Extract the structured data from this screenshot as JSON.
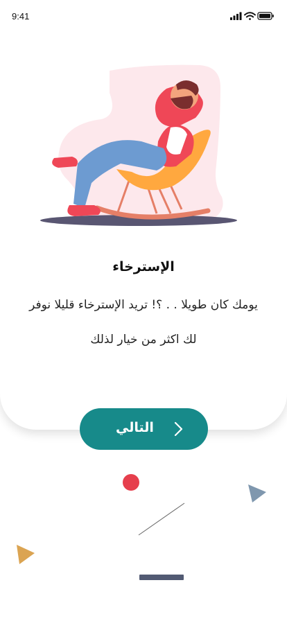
{
  "status_bar": {
    "time": "9:41"
  },
  "onboarding": {
    "title": "الإسترخاء",
    "description_line1": "يومك كان طويلا . . ؟! تريد الإسترخاء قليلا نوفر",
    "description_line2": "لك اكثر من خيار لذلك"
  },
  "next_button": {
    "label": "التالي"
  },
  "icons": {
    "next": "chevron-right-icon",
    "signal": "cellular-signal-icon",
    "wifi": "wifi-icon",
    "battery": "battery-icon"
  },
  "colors": {
    "accent": "#178a8a",
    "circle": "#e63f4d",
    "triangle_blue": "#7f97ae",
    "triangle_gold": "#dba452",
    "home_indicator": "#525a73",
    "blob": "#fde8ec"
  }
}
